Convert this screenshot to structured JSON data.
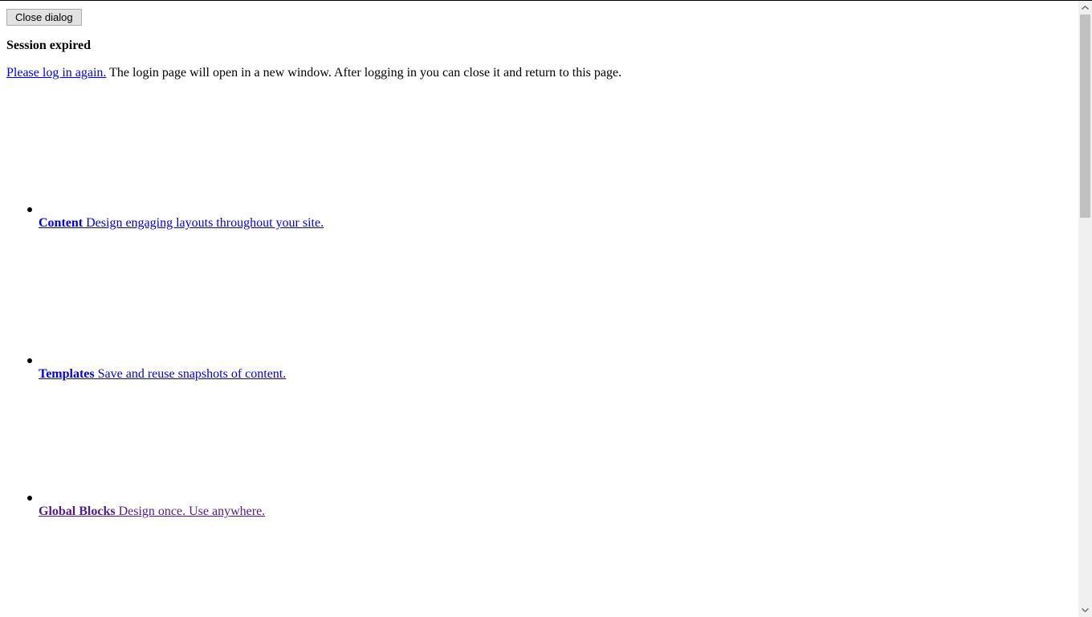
{
  "dialog": {
    "close_label": "Close dialog",
    "title": "Session expired",
    "login_link": "Please log in again.",
    "message": " The login page will open in a new window. After logging in you can close it and return to this page."
  },
  "features": [
    {
      "name": "Content",
      "description": " Design engaging layouts throughout your site."
    },
    {
      "name": "Templates",
      "description": " Save and reuse snapshots of content."
    },
    {
      "name": "Global Blocks",
      "description": " Design once. Use anywhere."
    }
  ],
  "colors": {
    "link": "#0000ee",
    "visited_link": "#551a8b"
  },
  "icons": {
    "scroll_up": "scroll-up-arrow-icon",
    "scroll_down": "scroll-down-arrow-icon",
    "bullet": "bullet-icon"
  }
}
